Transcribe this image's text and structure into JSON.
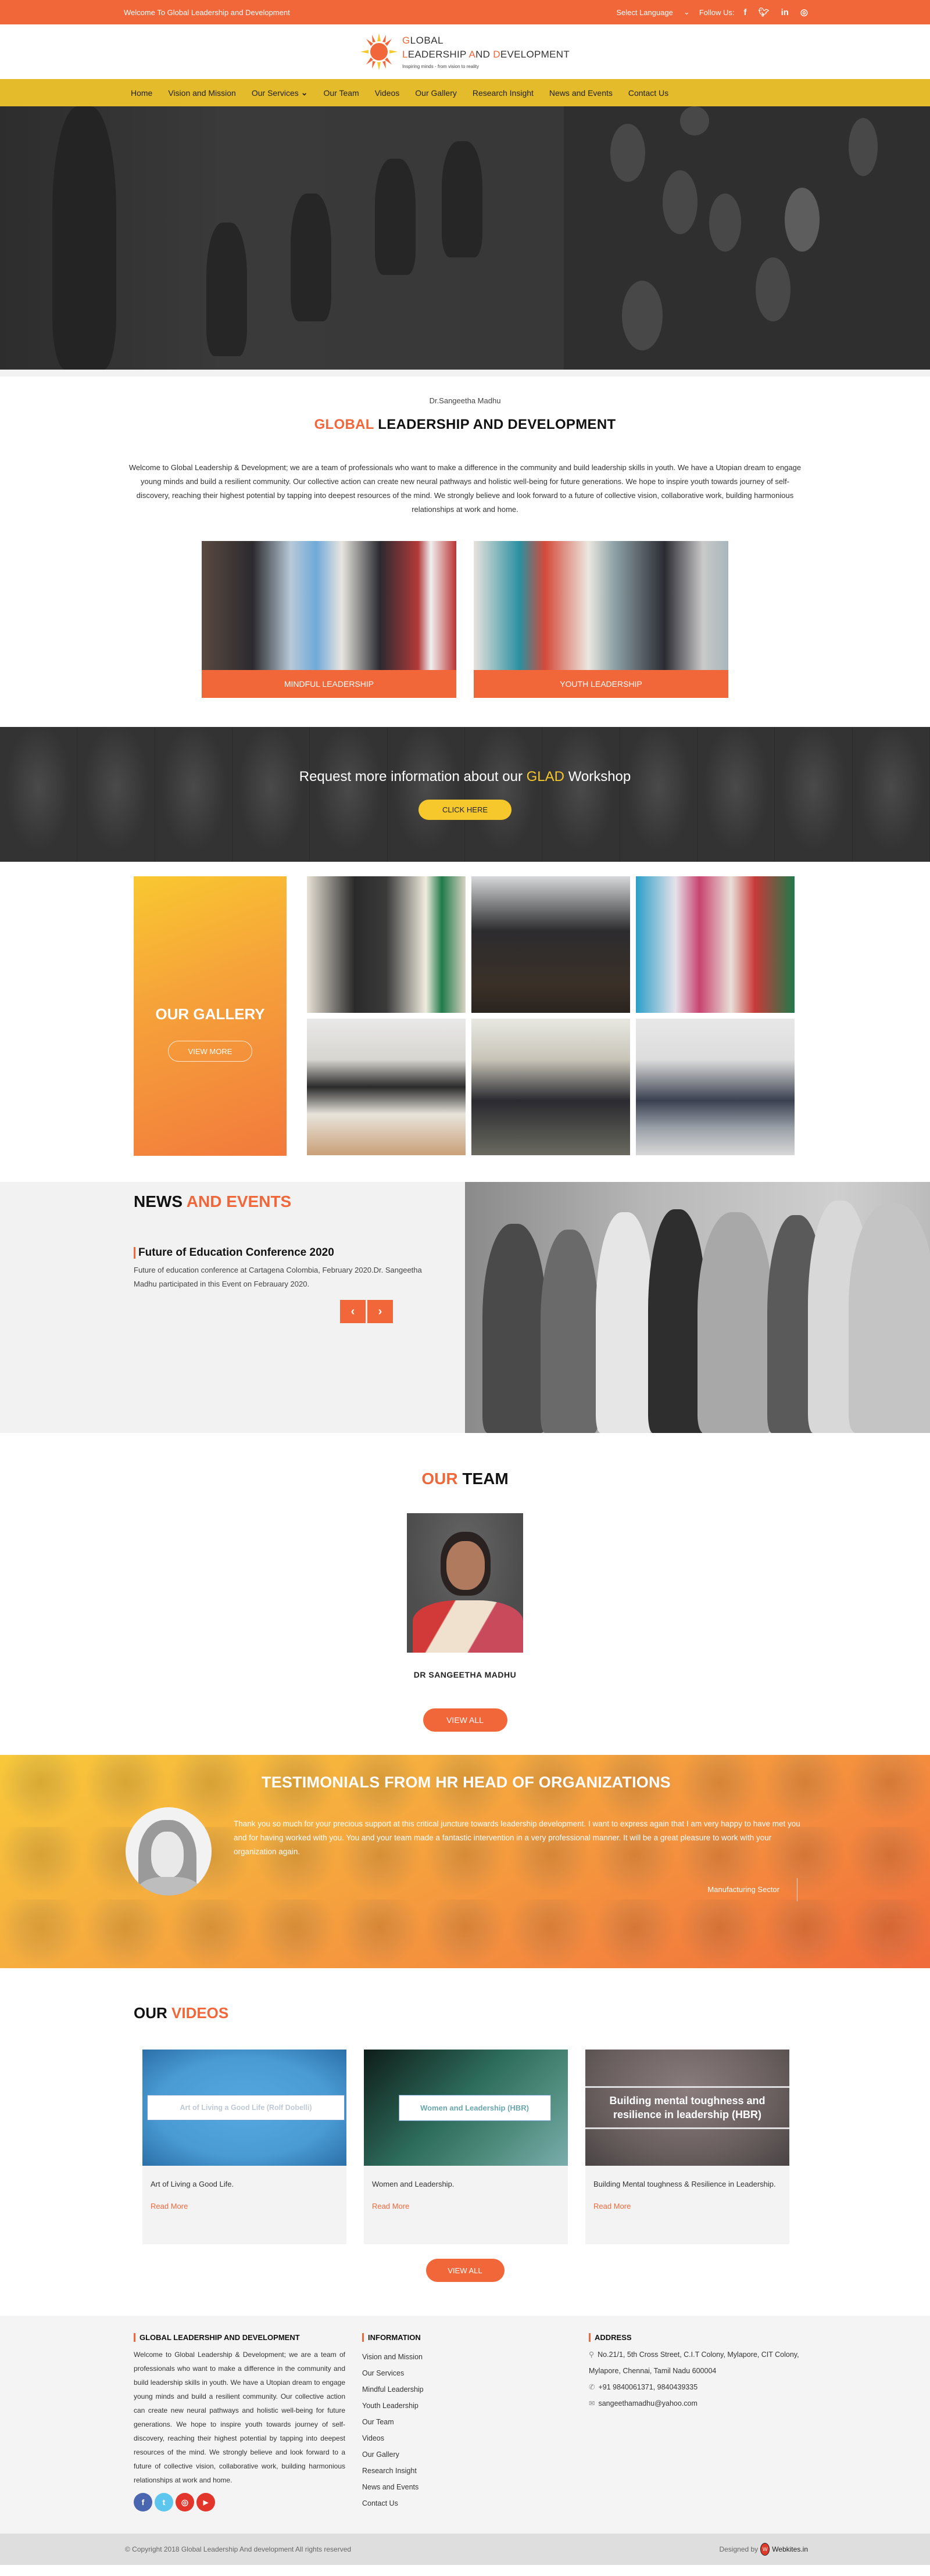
{
  "topbar": {
    "welcome": "Welcome To Global Leadership and Development",
    "language_select": "Select Language",
    "follow_label": "Follow Us:",
    "social": [
      {
        "icon": "facebook-icon",
        "glyph": "f"
      },
      {
        "icon": "twitter-icon",
        "glyph": "t"
      },
      {
        "icon": "linkedin-icon",
        "glyph": "in"
      },
      {
        "icon": "instagram-icon",
        "glyph": "◎"
      }
    ]
  },
  "logo": {
    "line1_initial": "G",
    "line1_rest": "LOBAL",
    "line2_l": "L",
    "line2_a": "EADERSHIP ",
    "line2_b": "A",
    "line2_c": "ND ",
    "line2_d": "D",
    "line2_e": "EVELOPMENT",
    "tagline": "Inspiring minds - from vision to reality"
  },
  "nav": {
    "items": [
      "Home",
      "Vision and Mission",
      "Our Services",
      "Our Team",
      "Videos",
      "Our Gallery",
      "Research Insight",
      "News and Events",
      "Contact Us"
    ],
    "dropdown_indicator": "⌄"
  },
  "intro": {
    "subtitle": "Dr.Sangeetha Madhu",
    "title_highlight": "GLOBAL",
    "title_rest": " LEADERSHIP AND DEVELOPMENT",
    "paragraph": "Welcome to Global Leadership & Development; we are a team of professionals who want to make a difference in the community and build leadership skills in youth. We have a Utopian dream to engage young minds and build a resilient community. Our collective action can create new neural pathways and holistic well-being for future generations. We hope to inspire youth towards journey of self- discovery, reaching their highest potential by tapping into deepest resources of the mind. We strongly believe and look forward to a future of collective vision, collaborative work, building harmonious relationships at work and home.",
    "cards": [
      {
        "caption": "MINDFUL LEADERSHIP"
      },
      {
        "caption": "YOUTH LEADERSHIP"
      }
    ]
  },
  "cta": {
    "text_before": "Request more information about our ",
    "text_highlight": "GLAD",
    "text_after": " Workshop",
    "button": "CLICK HERE"
  },
  "gallery": {
    "title": "OUR GALLERY",
    "button": "VIEW MORE",
    "photo_count": 6
  },
  "news": {
    "title_a": "NEWS ",
    "title_b": "AND EVENTS",
    "item_title": "Future of Education Conference 2020",
    "item_text": "Future of education conference at Cartagena Colombia, February 2020.Dr. Sangeetha Madhu participated in this Event on Febrauary 2020.",
    "prev": "‹",
    "next": "›"
  },
  "team": {
    "title_a": "OUR",
    "title_b": " TEAM",
    "member_name": "DR SANGEETHA MADHU",
    "button": "VIEW ALL"
  },
  "testimonials": {
    "title": "TESTIMONIALS FROM HR HEAD OF ORGANIZATIONS",
    "quote": "Thank you so much for your precious support at this critical juncture towards leadership development. I want to express again that I am very happy to have met you and for having worked with you. You and your team made a fantastic intervention in a very professional manner. It will be a great pleasure to work with your organization again.",
    "author": "Manufacturing Sector"
  },
  "videos": {
    "title_a": "OUR ",
    "title_b": "VIDEOS",
    "items": [
      {
        "thumb_text": "Art of Living a Good Life (Rolf Dobelli)",
        "title": "Art of Living a Good Life.",
        "link": "Read More"
      },
      {
        "thumb_text": "Women and Leadership (HBR)",
        "title": "Women and Leadership.",
        "link": "Read More"
      },
      {
        "thumb_text": "Building mental toughness and resilience in leadership (HBR)",
        "title": "Building Mental toughness & Resilience in Leadership.",
        "link": "Read More"
      }
    ],
    "button": "VIEW ALL"
  },
  "footer": {
    "about_title": "GLOBAL LEADERSHIP AND DEVELOPMENT",
    "about_text": "Welcome to Global Leadership & Development; we are a team of professionals who want to make a difference in the community and build leadership skills in youth. We have a Utopian dream to engage young minds and build a resilient community. Our collective action can create new neural pathways and holistic well-being for future generations. We hope to inspire youth towards journey of self- discovery, reaching their highest potential by tapping into deepest resources of the mind. We strongly believe and look forward to a future of collective vision, collaborative work, building harmonious relationships at work and home.",
    "social": [
      {
        "icon": "facebook-icon",
        "glyph": "f",
        "color": "#4a66b0"
      },
      {
        "icon": "twitter-icon",
        "glyph": "t",
        "color": "#5cc6ef"
      },
      {
        "icon": "instagram-icon",
        "glyph": "◎",
        "color": "#e2362c"
      },
      {
        "icon": "youtube-icon",
        "glyph": "▶",
        "color": "#e2362c"
      }
    ],
    "info_title": "INFORMATION",
    "info_links": [
      "Vision and Mission",
      "Our Services",
      "Mindful Leadership",
      "Youth Leadership",
      "Our Team",
      "Videos",
      "Our Gallery",
      "Research Insight",
      "News and Events",
      "Contact Us"
    ],
    "address_title": "ADDRESS",
    "address": "No.21/1, 5th Cross Street, C.I.T Colony, Mylapore, CIT Colony, Mylapore, Chennai, Tamil Nadu 600004",
    "phone": "+91 9840061371, 9840439335",
    "email": "sangeethamadhu@yahoo.com"
  },
  "copyright": {
    "text": "© Copyright 2018 Global Leadership And development All rights reserved",
    "designed_by": "Designed by",
    "designer": "Webkites.in",
    "designer_logo": "W"
  },
  "colors": {
    "primary_orange": "#f26739",
    "nav_yellow": "#e4bb2a",
    "cta_yellow": "#f7c82b"
  }
}
